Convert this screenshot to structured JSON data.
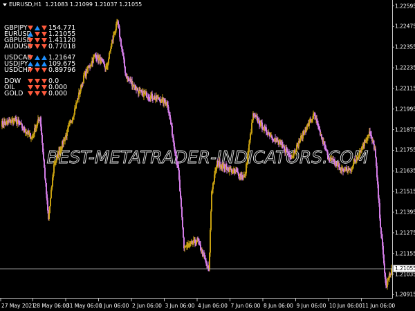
{
  "header": {
    "title": "EURUSD,H1",
    "ohlc": "1.21083 1.21099 1.21037 1.21055"
  },
  "panel": {
    "groups": [
      [
        {
          "symbol": "GBPJPY",
          "arrows": [
            "down",
            "up",
            "down"
          ],
          "value": "154.771"
        },
        {
          "symbol": "EURUSD",
          "arrows": [
            "up",
            "down",
            "down"
          ],
          "value": "1.21055"
        },
        {
          "symbol": "GBPUSD",
          "arrows": [
            "down",
            "down",
            "down"
          ],
          "value": "1.41120"
        },
        {
          "symbol": "AUDUSD",
          "arrows": [
            "down",
            "down",
            "down"
          ],
          "value": "0.77018"
        }
      ],
      [
        {
          "symbol": "USDCAD",
          "arrows": [
            "down",
            "up",
            "up"
          ],
          "value": "1.21647"
        },
        {
          "symbol": "USDJPY",
          "arrows": [
            "up",
            "up",
            "up"
          ],
          "value": "109.675"
        },
        {
          "symbol": "USDCHF",
          "arrows": [
            "down",
            "down",
            "down"
          ],
          "value": "0.89796"
        }
      ],
      [
        {
          "symbol": "DOW",
          "arrows": [
            "down",
            "down",
            "down"
          ],
          "value": "0.0"
        },
        {
          "symbol": "OIL",
          "arrows": [
            "down",
            "down",
            "down"
          ],
          "value": "0.000"
        },
        {
          "symbol": "GOLD",
          "arrows": [
            "down",
            "down",
            "down"
          ],
          "value": "0.000"
        }
      ]
    ]
  },
  "watermark": "BEST-METATRADER-INDICATORS.COM",
  "current_price": "1.21055",
  "colors": {
    "bull": "#c8a010",
    "bear": "#d27ce6",
    "grid": "#c0c0c0",
    "up_arrow": "#1e90ff",
    "down_arrow": "#ff5a3c"
  },
  "chart_data": {
    "type": "candlestick",
    "symbol": "EURUSD",
    "timeframe": "H1",
    "y_ticks": [
      "1.22595",
      "1.22475",
      "1.22355",
      "1.22235",
      "1.22115",
      "1.21995",
      "1.21875",
      "1.21755",
      "1.21635",
      "1.21515",
      "1.21395",
      "1.21275",
      "1.21155",
      "1.21035",
      "1.20915"
    ],
    "ylim": [
      1.2089,
      1.2262
    ],
    "x_ticks": [
      "27 May 2021",
      "28 May 06:00",
      "31 May 06:00",
      "1 Jun 06:00",
      "2 Jun 06:00",
      "3 Jun 06:00",
      "4 Jun 06:00",
      "7 Jun 06:00",
      "8 Jun 06:00",
      "9 Jun 06:00",
      "10 Jun 06:00",
      "11 Jun 06:00"
    ],
    "close_anchors": [
      [
        0,
        1.2191
      ],
      [
        5,
        1.2193
      ],
      [
        11,
        1.2183
      ],
      [
        14,
        1.2195
      ],
      [
        17,
        1.2135
      ],
      [
        19,
        1.2167
      ],
      [
        25,
        1.2191
      ],
      [
        30,
        1.2219
      ],
      [
        34,
        1.2231
      ],
      [
        38,
        1.2223
      ],
      [
        40,
        1.2239
      ],
      [
        42,
        1.225
      ],
      [
        45,
        1.2219
      ],
      [
        50,
        1.2209
      ],
      [
        54,
        1.2207
      ],
      [
        60,
        1.2203
      ],
      [
        64,
        1.2163
      ],
      [
        66,
        1.2119
      ],
      [
        71,
        1.2123
      ],
      [
        75,
        1.2105
      ],
      [
        76,
        1.2152
      ],
      [
        78,
        1.2168
      ],
      [
        83,
        1.2164
      ],
      [
        88,
        1.216
      ],
      [
        91,
        1.2196
      ],
      [
        95,
        1.2188
      ],
      [
        100,
        1.218
      ],
      [
        105,
        1.2172
      ],
      [
        110,
        1.2188
      ],
      [
        113,
        1.2196
      ],
      [
        118,
        1.2172
      ],
      [
        123,
        1.2164
      ],
      [
        126,
        1.2164
      ],
      [
        130,
        1.2176
      ],
      [
        133,
        1.2186
      ],
      [
        135,
        1.2176
      ],
      [
        137,
        1.2132
      ],
      [
        139,
        1.2096
      ],
      [
        141,
        1.2106
      ]
    ]
  }
}
